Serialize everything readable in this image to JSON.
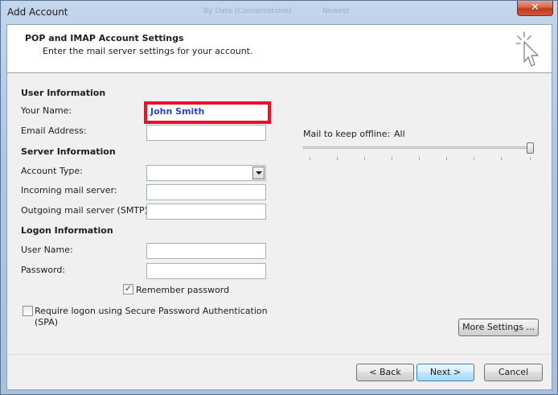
{
  "window": {
    "title": "Add Account",
    "background_ghost": [
      "By Date (Conversations)",
      "Newest"
    ]
  },
  "header": {
    "title": "POP and IMAP Account Settings",
    "subtitle": "Enter the mail server settings for your account.",
    "icon": "cursor-sparkle-icon"
  },
  "user_info": {
    "heading": "User Information",
    "name_label": "Your Name:",
    "name_value": "John Smith",
    "email_label": "Email Address:",
    "email_value": ""
  },
  "server_info": {
    "heading": "Server Information",
    "account_type_label": "Account Type:",
    "account_type_value": "",
    "incoming_label": "Incoming mail server:",
    "incoming_value": "",
    "outgoing_label": "Outgoing mail server (SMTP):",
    "outgoing_value": ""
  },
  "logon_info": {
    "heading": "Logon Information",
    "username_label": "User Name:",
    "username_value": "",
    "password_label": "Password:",
    "password_value": "",
    "remember_label": "Remember password",
    "remember_checked": true,
    "spa_label": "Require logon using Secure Password Authentication",
    "spa_label_line2": "(SPA)",
    "spa_checked": false
  },
  "offline": {
    "label": "Mail to keep offline:",
    "value": "All",
    "slider_fraction": 1.0
  },
  "buttons": {
    "more_settings": "More Settings ...",
    "back": "< Back",
    "next": "Next >",
    "cancel": "Cancel"
  },
  "colors": {
    "highlight_border": "#e8132a",
    "name_text": "#2f3fc8"
  }
}
